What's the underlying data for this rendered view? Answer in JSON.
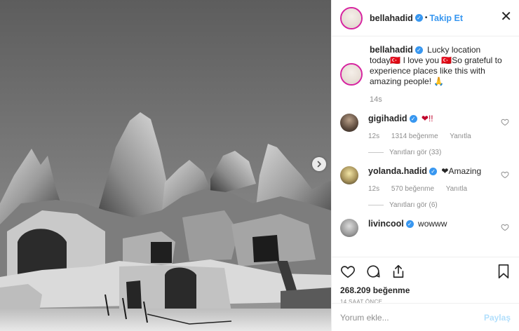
{
  "header": {
    "username": "bellahadid",
    "separator": "•",
    "follow_label": "Takip Et",
    "close_label": "✕"
  },
  "caption": {
    "username": "bellahadid",
    "text": "Lucky location today🇹🇷 I love you 🇹🇷So grateful to experience places like this with amazing people! 🙏",
    "time": "14s"
  },
  "comments": [
    {
      "username": "gigihadid",
      "text": "❤!!",
      "time": "12s",
      "likes": "1314 beğenme",
      "reply": "Yanıtla",
      "view_replies": "Yanıtları gör (33)"
    },
    {
      "username": "yolanda.hadid",
      "text": "❤Amazing",
      "time": "12s",
      "likes": "570 beğenme",
      "reply": "Yanıtla",
      "view_replies": "Yanıtları gör (6)"
    },
    {
      "username": "livincool",
      "text": "wowww"
    }
  ],
  "actions": {
    "likes": "268.209 beğenme",
    "time_ago": "14 SAAT ÖNCE"
  },
  "add_comment": {
    "placeholder": "Yorum ekle...",
    "post_label": "Paylaş"
  },
  "icons": {
    "like": "heart-icon",
    "comment": "comment-icon",
    "share": "share-icon",
    "save": "bookmark-icon",
    "next": "chevron-right-icon",
    "verified": "verified-badge-icon"
  },
  "colors": {
    "accent": "#3897f0",
    "verified": "#3897f0",
    "post_disabled": "#b2dffc",
    "muted": "#8e8e8e",
    "heart_red": "#ed4956"
  }
}
